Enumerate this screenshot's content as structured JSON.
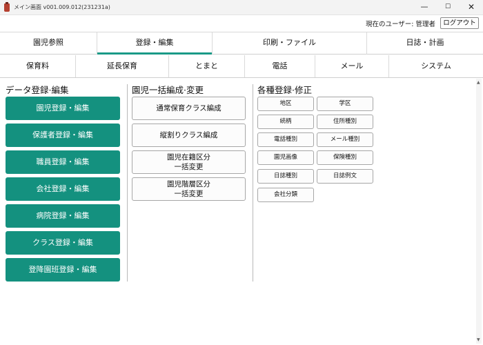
{
  "window": {
    "title": "メイン画面 v001.009.012(231231a)",
    "minimize": "—",
    "maximize": "☐",
    "close": "✕"
  },
  "user": {
    "label": "現在のユーザー: 管理者",
    "logout": "ログアウト"
  },
  "main_tabs": [
    "園児参照",
    "登録・編集",
    "印刷・ファイル",
    "日誌・計画"
  ],
  "active_main_tab": "登録・編集",
  "sub_tabs": [
    "保育料",
    "延長保育",
    "とまと",
    "電話",
    "メール",
    "システム"
  ],
  "sections": {
    "data_edit": {
      "title": "データ登録·編集",
      "buttons": [
        "園児登録・編集",
        "保護者登録・編集",
        "職員登録・編集",
        "会社登録・編集",
        "病院登録・編集",
        "クラス登録・編集",
        "登降園班登録・編集"
      ]
    },
    "bulk": {
      "title": "園児一括編成·変更",
      "buttons": [
        "通常保育クラス編成",
        "縦割りクラス編成",
        "園児在籍区分\n一括変更",
        "園児階層区分\n一括変更"
      ]
    },
    "misc": {
      "title": "各種登録·修正",
      "buttons": [
        "地区",
        "学区",
        "続柄",
        "住所種別",
        "電話種別",
        "メール種別",
        "園児画像",
        "保険種別",
        "日誌種別",
        "日誌例文",
        "会社分類"
      ]
    }
  },
  "colors": {
    "accent": "#14917f",
    "tab_underline": "#1a9a87"
  }
}
